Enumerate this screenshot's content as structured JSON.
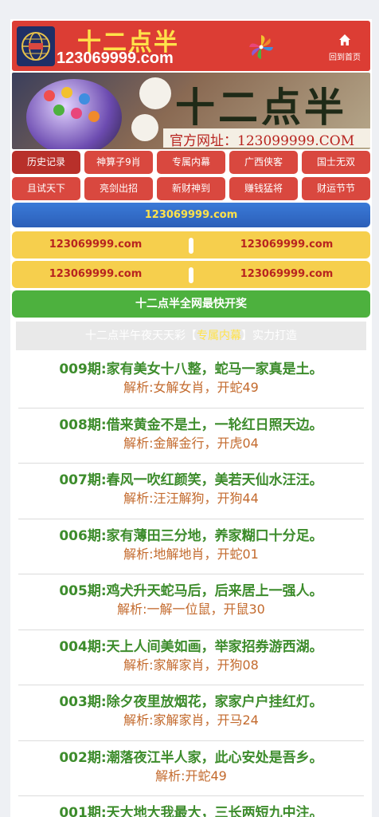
{
  "header": {
    "brand_name": "十二点半",
    "brand_domain": "123069999.com",
    "home_label": "回到首页"
  },
  "banner": {
    "title": "十二点半",
    "url_text": "官方网址：123099999.COM"
  },
  "nav": {
    "items": [
      {
        "label": "历史记录"
      },
      {
        "label": "神算子9肖"
      },
      {
        "label": "专属内幕"
      },
      {
        "label": "广西侠客"
      },
      {
        "label": "国士无双"
      },
      {
        "label": "且试天下"
      },
      {
        "label": "亮剑出招"
      },
      {
        "label": "新财神到"
      },
      {
        "label": "赚钱猛将"
      },
      {
        "label": "财运节节"
      }
    ]
  },
  "blue_bar": {
    "text": "123069999.com"
  },
  "yellow_rows": [
    {
      "left": "123069999.com",
      "right": "123069999.com"
    },
    {
      "left": "123069999.com",
      "right": "123069999.com"
    }
  ],
  "green_button": {
    "label": "十二点半全网最快开奖"
  },
  "tagline": {
    "prefix": "十二点半午夜天天彩【",
    "highlight": "专属内幕",
    "suffix": "】实力打造"
  },
  "entries": [
    {
      "title": "009期:家有美女十八整，蛇马一家真是土。",
      "answer": "解析:女解女肖，开蛇49"
    },
    {
      "title": "008期:借来黄金不是土，一轮红日照天边。",
      "answer": "解析:金解金行，开虎04"
    },
    {
      "title": "007期:春风一吹红颜笑，美若天仙水汪汪。",
      "answer": "解析:汪汪解狗，开狗44"
    },
    {
      "title": "006期:家有薄田三分地，养家糊口十分足。",
      "answer": "解析:地解地肖，开蛇01"
    },
    {
      "title": "005期:鸡犬升天蛇马后，后来居上一强人。",
      "answer": "解析:一解一位鼠，开鼠30"
    },
    {
      "title": "004期:天上人间美如画，举家招券游西湖。",
      "answer": "解析:家解家肖，开狗08"
    },
    {
      "title": "003期:除夕夜里放烟花，家家户户挂红灯。",
      "answer": "解析:家解家肖，开马24"
    },
    {
      "title": "002期:潮落夜江半人家，此心安处是吾乡。",
      "answer": "解析:开蛇49"
    },
    {
      "title": "001期:天大地大我最大，三长两短九中注。",
      "answer": ""
    }
  ],
  "colors": {
    "header_red": "#dc3d34",
    "brand_yellow": "#ffe24a",
    "nav_red": "#d9483f",
    "blue_bar": "#2c5fb8",
    "yellow_bar": "#f6cf4d",
    "green_button": "#4db13e",
    "entry_title_green": "#3d8c2c",
    "entry_answer_orange": "#c36a2d"
  },
  "icons": [
    "globe-logo-icon",
    "pinwheel-icon",
    "home-icon"
  ]
}
